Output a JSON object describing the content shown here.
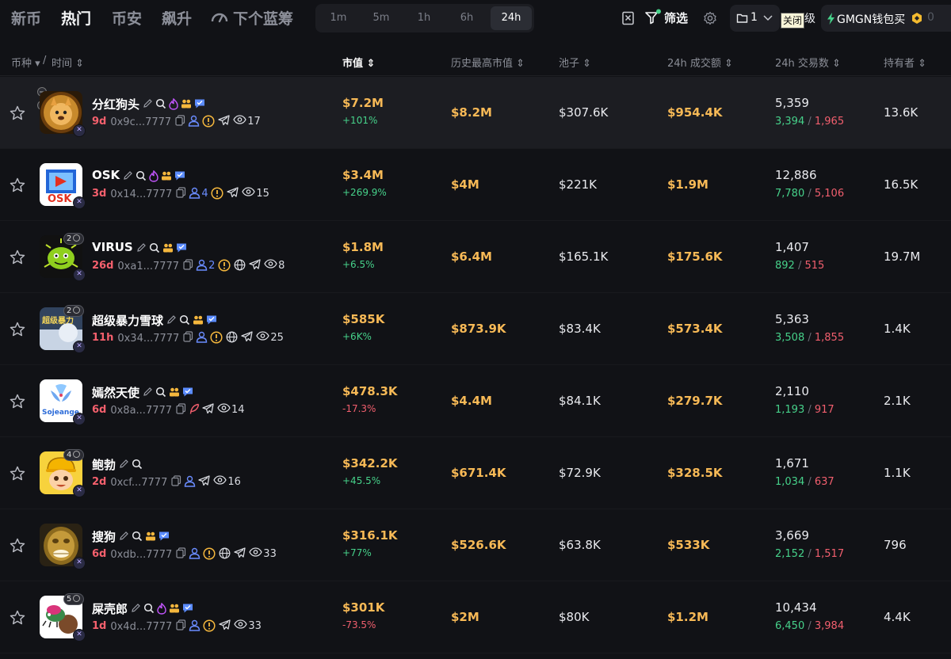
{
  "nav": {
    "tabs": [
      {
        "label": "新币",
        "active": false
      },
      {
        "label": "热门",
        "active": true
      },
      {
        "label": "币安",
        "active": false
      },
      {
        "label": "飙升",
        "active": false
      },
      {
        "label": "下个蓝筹",
        "active": false
      }
    ],
    "timeframes": [
      {
        "label": "1m",
        "active": false
      },
      {
        "label": "5m",
        "active": false
      },
      {
        "label": "1h",
        "active": false
      },
      {
        "label": "6h",
        "active": false
      },
      {
        "label": "24h",
        "active": true
      }
    ],
    "filter_label": "筛选",
    "preset_num": "1",
    "tooltip": "关闭",
    "grade_text": "级",
    "buy_label": "GMGN钱包买",
    "buy_amount": "0"
  },
  "columns": {
    "coin": "币种",
    "time": "时间",
    "mcap": "市值",
    "ath": "历史最高市值",
    "pool": "池子",
    "vol": "24h 成交额",
    "txcount": "24h 交易数",
    "holders": "持有者"
  },
  "colors": {
    "gold": "#f7b956",
    "up": "#46d18a",
    "down": "#f25f6e",
    "age": "#f5606d",
    "social_blue": "#5b8cff",
    "fire": "#c456ff",
    "warn": "#f5b73d"
  },
  "rows": [
    {
      "name": "分红狗头",
      "age": "9d",
      "addr": "0x9c...7777",
      "holders_icon_count": "",
      "views": "17",
      "mcap": "$7.2M",
      "change": "+101%",
      "dir": "up",
      "ath": "$8.2M",
      "pool": "$307.6K",
      "vol": "$954.4K",
      "tx": "5,359",
      "buys": "3,394",
      "sells": "1,965",
      "holders": "13.6K",
      "badge_count": "",
      "icons_top": [
        "edit-icon",
        "search-icon",
        "fire-icon",
        "users-icon",
        "verified-icon"
      ],
      "icons_bottom": [
        "copy-icon",
        "user-icon",
        "warning-icon",
        "telegram-icon",
        "eye-icon"
      ],
      "avatar": "dog"
    },
    {
      "name": "OSK",
      "age": "3d",
      "addr": "0x14...7777",
      "holders_icon_count": "4",
      "views": "15",
      "mcap": "$3.4M",
      "change": "+269.9%",
      "dir": "up",
      "ath": "$4M",
      "pool": "$221K",
      "vol": "$1.9M",
      "tx": "12,886",
      "buys": "7,780",
      "sells": "5,106",
      "holders": "16.5K",
      "badge_count": "",
      "icons_top": [
        "edit-icon",
        "search-icon",
        "fire-icon",
        "users-icon",
        "verified-icon"
      ],
      "icons_bottom": [
        "copy-icon",
        "user-icon",
        "warning-icon",
        "telegram-icon",
        "eye-icon"
      ],
      "avatar": "osk"
    },
    {
      "name": "VIRUS",
      "age": "26d",
      "addr": "0xa1...7777",
      "holders_icon_count": "2",
      "views": "8",
      "mcap": "$1.8M",
      "change": "+6.5%",
      "dir": "up",
      "ath": "$6.4M",
      "pool": "$165.1K",
      "vol": "$175.6K",
      "tx": "1,407",
      "buys": "892",
      "sells": "515",
      "holders": "19.7M",
      "badge_count": "2",
      "icons_top": [
        "edit-icon",
        "search-icon",
        "users-icon",
        "verified-icon"
      ],
      "icons_bottom": [
        "copy-icon",
        "user-icon",
        "warning-icon",
        "globe-icon",
        "telegram-icon",
        "eye-icon"
      ],
      "avatar": "virus"
    },
    {
      "name": "超级暴力雪球",
      "age": "11h",
      "addr": "0x34...7777",
      "holders_icon_count": "",
      "views": "25",
      "mcap": "$585K",
      "change": "+6K%",
      "dir": "up",
      "ath": "$873.9K",
      "pool": "$83.4K",
      "vol": "$573.4K",
      "tx": "5,363",
      "buys": "3,508",
      "sells": "1,855",
      "holders": "1.4K",
      "badge_count": "2",
      "icons_top": [
        "edit-icon",
        "search-icon",
        "users-icon",
        "verified-icon"
      ],
      "icons_bottom": [
        "copy-icon",
        "user-icon",
        "warning-icon",
        "globe-icon",
        "telegram-icon",
        "eye-icon"
      ],
      "avatar": "snow"
    },
    {
      "name": "嫣然天使",
      "age": "6d",
      "addr": "0x8a...7777",
      "holders_icon_count": "",
      "views": "14",
      "mcap": "$478.3K",
      "change": "-17.3%",
      "dir": "dn",
      "ath": "$4.4M",
      "pool": "$84.1K",
      "vol": "$279.7K",
      "tx": "2,110",
      "buys": "1,193",
      "sells": "917",
      "holders": "2.1K",
      "badge_count": "",
      "icons_top": [
        "edit-icon",
        "search-icon",
        "users-icon",
        "verified-icon"
      ],
      "icons_bottom": [
        "copy-icon",
        "feather-icon",
        "telegram-icon",
        "eye-icon"
      ],
      "avatar": "angel"
    },
    {
      "name": "鲍勃",
      "age": "2d",
      "addr": "0xcf...7777",
      "holders_icon_count": "",
      "views": "16",
      "mcap": "$342.2K",
      "change": "+45.5%",
      "dir": "up",
      "ath": "$671.4K",
      "pool": "$72.9K",
      "vol": "$328.5K",
      "tx": "1,671",
      "buys": "1,034",
      "sells": "637",
      "holders": "1.1K",
      "badge_count": "4",
      "icons_top": [
        "edit-icon",
        "search-icon"
      ],
      "icons_bottom": [
        "copy-icon",
        "user-icon",
        "telegram-icon",
        "eye-icon"
      ],
      "avatar": "bob"
    },
    {
      "name": "搜狗",
      "age": "6d",
      "addr": "0xdb...7777",
      "holders_icon_count": "",
      "views": "33",
      "mcap": "$316.1K",
      "change": "+77%",
      "dir": "up",
      "ath": "$526.6K",
      "pool": "$63.8K",
      "vol": "$533K",
      "tx": "3,669",
      "buys": "2,152",
      "sells": "1,517",
      "holders": "796",
      "badge_count": "",
      "icons_top": [
        "edit-icon",
        "search-icon",
        "users-icon",
        "verified-icon"
      ],
      "icons_bottom": [
        "copy-icon",
        "user-icon",
        "warning-icon",
        "globe-icon",
        "telegram-icon",
        "eye-icon"
      ],
      "avatar": "gold"
    },
    {
      "name": "屎壳郎",
      "age": "1d",
      "addr": "0x4d...7777",
      "holders_icon_count": "",
      "views": "33",
      "mcap": "$301K",
      "change": "-73.5%",
      "dir": "dn",
      "ath": "$2M",
      "pool": "$80K",
      "vol": "$1.2M",
      "tx": "10,434",
      "buys": "6,450",
      "sells": "3,984",
      "holders": "4.4K",
      "badge_count": "5",
      "icons_top": [
        "edit-icon",
        "search-icon",
        "fire-icon",
        "users-icon",
        "verified-icon"
      ],
      "icons_bottom": [
        "copy-icon",
        "user-icon",
        "warning-icon",
        "telegram-icon",
        "eye-icon"
      ],
      "avatar": "beetle"
    }
  ]
}
